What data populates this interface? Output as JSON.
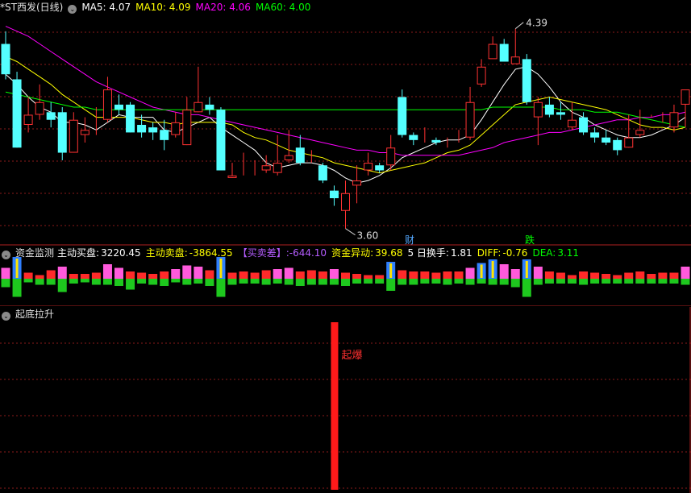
{
  "main_header": {
    "title": "*ST西发(日线)",
    "ma5": "MA5: 4.07",
    "ma10": "MA10: 4.09",
    "ma20": "MA20: 4.06",
    "ma60": "MA60: 4.00"
  },
  "fund_header": {
    "title": "资金监测",
    "buy_label": "主动买盘:",
    "buy_value": "3220.45",
    "sell_label": "主动卖盘:",
    "sell_value": "-3864.55",
    "diff_label": "【买卖差】:",
    "diff_value": "-644.10",
    "abn_label": "资金异动:",
    "abn_value": "39.68",
    "turn_label": "5 日换手:",
    "turn_value": "1.81",
    "diff2_label": "DIFF:",
    "diff2_value": "-0.76",
    "dea_label": "DEA:",
    "dea_value": "3.11"
  },
  "bottom_header": {
    "title": "起底拉升"
  },
  "annotations": {
    "high": "4.39",
    "low": "3.60",
    "cai": "财",
    "die": "跌",
    "qibao": "起爆"
  },
  "colors": {
    "up": "#ff3232",
    "down": "#54ffff",
    "ma5": "#ffffff",
    "ma10": "#ffff00",
    "ma20": "#ff00ff",
    "ma60": "#00ff00",
    "grid": "#8a1a1a",
    "signal": "#ff1a1a"
  },
  "chart_data": {
    "type": "candlestick",
    "candles": [
      [
        4.33,
        4.21,
        4.38,
        4.19
      ],
      [
        4.19,
        3.92,
        4.22,
        3.92
      ],
      [
        4.01,
        4.05,
        4.12,
        3.98
      ],
      [
        4.05,
        4.1,
        4.17,
        4.03
      ],
      [
        4.06,
        4.03,
        4.1,
        4.0
      ],
      [
        4.06,
        3.9,
        4.08,
        3.87
      ],
      [
        3.9,
        4.03,
        4.06,
        3.9
      ],
      [
        3.97,
        3.99,
        4.04,
        3.94
      ],
      [
        4.01,
        4.01,
        4.08,
        3.97
      ],
      [
        4.03,
        4.15,
        4.2,
        4.02
      ],
      [
        4.09,
        4.07,
        4.13,
        4.05
      ],
      [
        4.09,
        3.98,
        4.1,
        3.98
      ],
      [
        4.01,
        3.98,
        4.05,
        3.96
      ],
      [
        4.0,
        3.98,
        4.02,
        3.95
      ],
      [
        3.99,
        3.95,
        4.03,
        3.91
      ],
      [
        3.97,
        4.02,
        4.06,
        3.96
      ],
      [
        3.93,
        4.07,
        4.12,
        3.93
      ],
      [
        4.06,
        4.1,
        4.24,
        4.06
      ],
      [
        4.09,
        4.07,
        4.12,
        4.05
      ],
      [
        4.07,
        3.83,
        4.08,
        3.83
      ],
      [
        3.8,
        3.81,
        3.86,
        3.8
      ],
      [
        3.82,
        3.82,
        3.9,
        3.81
      ],
      [
        3.82,
        3.82,
        3.87,
        3.81
      ],
      [
        3.83,
        3.85,
        3.89,
        3.82
      ],
      [
        3.82,
        3.86,
        3.97,
        3.81
      ],
      [
        3.87,
        3.89,
        3.99,
        3.86
      ],
      [
        3.92,
        3.86,
        3.97,
        3.85
      ],
      [
        3.87,
        3.87,
        3.91,
        3.86
      ],
      [
        3.85,
        3.79,
        3.86,
        3.78
      ],
      [
        3.75,
        3.72,
        3.77,
        3.69
      ],
      [
        3.67,
        3.74,
        3.79,
        3.6
      ],
      [
        3.77,
        3.79,
        3.85,
        3.7
      ],
      [
        3.83,
        3.86,
        3.9,
        3.81
      ],
      [
        3.85,
        3.83,
        3.86,
        3.82
      ],
      [
        3.85,
        3.92,
        3.97,
        3.83
      ],
      [
        4.12,
        3.97,
        4.15,
        3.96
      ],
      [
        3.97,
        3.95,
        3.98,
        3.93
      ],
      [
        3.94,
        3.94,
        4.0,
        3.94
      ],
      [
        3.95,
        3.94,
        3.96,
        3.93
      ],
      [
        3.94,
        3.94,
        3.96,
        3.92
      ],
      [
        3.95,
        3.95,
        3.99,
        3.94
      ],
      [
        3.96,
        4.1,
        4.16,
        3.95
      ],
      [
        4.17,
        4.24,
        4.27,
        4.16
      ],
      [
        4.27,
        4.33,
        4.36,
        4.28
      ],
      [
        4.33,
        4.26,
        4.35,
        4.26
      ],
      [
        4.25,
        4.28,
        4.39,
        4.27
      ],
      [
        4.27,
        4.1,
        4.29,
        4.09
      ],
      [
        4.04,
        4.1,
        4.12,
        3.93
      ],
      [
        4.09,
        4.05,
        4.12,
        4.04
      ],
      [
        4.06,
        4.05,
        4.1,
        4.03
      ],
      [
        4.0,
        4.03,
        4.1,
        3.99
      ],
      [
        4.04,
        3.98,
        4.06,
        3.97
      ],
      [
        3.98,
        3.96,
        4.0,
        3.94
      ],
      [
        3.96,
        3.94,
        3.99,
        3.93
      ],
      [
        3.95,
        3.91,
        3.96,
        3.89
      ],
      [
        3.92,
        3.96,
        4.05,
        3.92
      ],
      [
        3.97,
        3.99,
        4.07,
        3.96
      ],
      [
        4.04,
        4.04,
        4.05,
        4.04
      ],
      [
        4.04,
        4.04,
        4.06,
        4.02
      ],
      [
        4.0,
        4.06,
        4.09,
        3.98
      ],
      [
        4.09,
        4.15,
        4.14,
        4.0
      ]
    ],
    "y_range": [
      3.58,
      4.44
    ],
    "high_label": 4.39,
    "low_label": 3.6,
    "ma_series": [
      {
        "name": "MA5",
        "color": "#ffffff",
        "values": [
          4.21,
          4.17,
          4.12,
          4.08,
          4.06,
          4.02,
          4.02,
          4.01,
          3.99,
          4.02,
          4.05,
          4.04,
          4.04,
          4.04,
          3.99,
          3.98,
          4.0,
          4.02,
          4.04,
          4.0,
          3.97,
          3.94,
          3.91,
          3.86,
          3.84,
          3.85,
          3.86,
          3.86,
          3.85,
          3.83,
          3.8,
          3.78,
          3.79,
          3.81,
          3.84,
          3.88,
          3.9,
          3.92,
          3.94,
          3.95,
          3.95,
          3.97,
          4.03,
          4.1,
          4.17,
          4.23,
          4.24,
          4.21,
          4.16,
          4.1,
          4.06,
          4.04,
          4.01,
          3.99,
          3.97,
          3.96,
          3.96,
          3.97,
          3.99,
          4.01,
          4.04
        ]
      },
      {
        "name": "MA10",
        "color": "#ffff00",
        "values": [
          4.28,
          4.26,
          4.23,
          4.2,
          4.17,
          4.13,
          4.1,
          4.07,
          4.04,
          4.04,
          4.04,
          4.04,
          4.03,
          4.02,
          4.02,
          4.01,
          4.02,
          4.02,
          4.02,
          4.02,
          4.01,
          3.98,
          3.96,
          3.95,
          3.93,
          3.91,
          3.9,
          3.89,
          3.88,
          3.86,
          3.85,
          3.84,
          3.83,
          3.82,
          3.83,
          3.84,
          3.85,
          3.86,
          3.88,
          3.9,
          3.91,
          3.93,
          3.97,
          4.01,
          4.05,
          4.09,
          4.1,
          4.11,
          4.12,
          4.11,
          4.1,
          4.09,
          4.08,
          4.07,
          4.05,
          4.03,
          4.01,
          4.0,
          4.0,
          3.99,
          4.0
        ]
      },
      {
        "name": "MA20",
        "color": "#ff00ff",
        "values": [
          4.4,
          4.38,
          4.36,
          4.33,
          4.3,
          4.27,
          4.24,
          4.21,
          4.18,
          4.16,
          4.14,
          4.12,
          4.1,
          4.08,
          4.07,
          4.06,
          4.05,
          4.05,
          4.04,
          4.03,
          4.02,
          4.01,
          4.0,
          3.99,
          3.98,
          3.97,
          3.96,
          3.95,
          3.94,
          3.93,
          3.92,
          3.91,
          3.91,
          3.9,
          3.9,
          3.89,
          3.89,
          3.89,
          3.89,
          3.89,
          3.89,
          3.9,
          3.91,
          3.92,
          3.94,
          3.95,
          3.96,
          3.97,
          3.98,
          3.98,
          3.99,
          4.0,
          4.01,
          4.02,
          4.03,
          4.03,
          4.04,
          4.04,
          4.05,
          4.05,
          4.06
        ]
      },
      {
        "name": "MA60",
        "color": "#00ff00",
        "values": [
          4.14,
          4.13,
          4.12,
          4.11,
          4.1,
          4.09,
          4.08,
          4.08,
          4.07,
          4.07,
          4.07,
          4.07,
          4.07,
          4.07,
          4.07,
          4.07,
          4.07,
          4.07,
          4.07,
          4.07,
          4.07,
          4.07,
          4.07,
          4.07,
          4.07,
          4.07,
          4.07,
          4.07,
          4.07,
          4.07,
          4.07,
          4.07,
          4.07,
          4.07,
          4.07,
          4.07,
          4.07,
          4.07,
          4.07,
          4.07,
          4.07,
          4.07,
          4.07,
          4.08,
          4.08,
          4.08,
          4.08,
          4.08,
          4.08,
          4.07,
          4.07,
          4.07,
          4.06,
          4.06,
          4.06,
          4.05,
          4.04,
          4.03,
          4.02,
          4.01,
          4.0
        ]
      }
    ],
    "fund_flow": {
      "buy": [
        0.9,
        1.8,
        0.5,
        0.3,
        0.7,
        1.0,
        0.4,
        0.4,
        0.5,
        1.2,
        0.9,
        0.6,
        0.5,
        0.4,
        0.6,
        0.8,
        1.1,
        1.0,
        0.7,
        1.8,
        0.5,
        0.6,
        0.5,
        0.7,
        0.8,
        0.9,
        0.6,
        0.7,
        0.6,
        0.8,
        0.5,
        0.4,
        0.3,
        0.3,
        1.4,
        0.7,
        0.6,
        0.6,
        0.5,
        0.6,
        0.6,
        0.9,
        1.3,
        1.6,
        1.2,
        0.8,
        1.6,
        1.0,
        0.6,
        0.5,
        0.3,
        0.6,
        0.5,
        0.4,
        0.3,
        0.5,
        0.6,
        0.4,
        0.5,
        0.5,
        1.0
      ],
      "sell": [
        -0.7,
        -1.5,
        -0.3,
        -0.5,
        -0.5,
        -1.1,
        -0.4,
        -0.3,
        -0.5,
        -0.5,
        -0.6,
        -0.9,
        -0.4,
        -0.5,
        -0.6,
        -0.3,
        -0.5,
        -0.4,
        -0.6,
        -1.5,
        -0.5,
        -0.4,
        -0.4,
        -0.5,
        -0.4,
        -0.5,
        -0.6,
        -0.5,
        -0.5,
        -0.5,
        -0.6,
        -0.4,
        -0.4,
        -0.4,
        -1.0,
        -0.5,
        -0.5,
        -0.4,
        -0.4,
        -0.5,
        -0.4,
        -0.5,
        -0.4,
        -0.5,
        -0.5,
        -0.7,
        -1.5,
        -0.5,
        -0.4,
        -0.4,
        -0.4,
        -0.5,
        -0.4,
        -0.4,
        -0.4,
        -0.4,
        -0.4,
        -0.4,
        -0.4,
        -0.4,
        -0.5
      ]
    },
    "signal": {
      "index": 29,
      "label": "起爆"
    }
  }
}
